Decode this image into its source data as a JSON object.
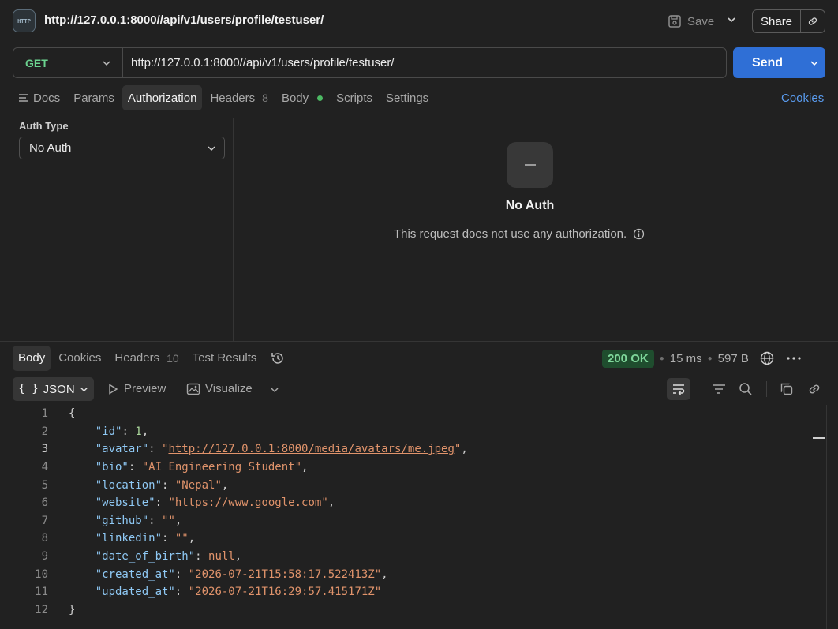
{
  "title": "http://127.0.0.1:8000//api/v1/users/profile/testuser/",
  "http_icon_text": "HTTP",
  "header": {
    "save_label": "Save",
    "share_label": "Share"
  },
  "request": {
    "method": "GET",
    "url": "http://127.0.0.1:8000//api/v1/users/profile/testuser/",
    "send_label": "Send"
  },
  "request_tabs": {
    "docs": "Docs",
    "params": "Params",
    "authorization": "Authorization",
    "headers": "Headers",
    "headers_count": "8",
    "body": "Body",
    "scripts": "Scripts",
    "settings": "Settings",
    "cookies": "Cookies"
  },
  "auth": {
    "type_label": "Auth Type",
    "selected": "No Auth",
    "empty_title": "No Auth",
    "empty_desc": "This request does not use any authorization."
  },
  "response_tabs": {
    "body": "Body",
    "cookies": "Cookies",
    "headers": "Headers",
    "headers_count": "10",
    "test_results": "Test Results"
  },
  "response_status": {
    "code": "200 OK",
    "time": "15 ms",
    "size": "597 B"
  },
  "response_toolbar": {
    "format_braces": "{ }",
    "format": "JSON",
    "preview": "Preview",
    "visualize": "Visualize"
  },
  "code_lines": [
    {
      "n": "1",
      "tokens": [
        {
          "t": "{",
          "c": "p"
        }
      ]
    },
    {
      "n": "2",
      "tokens": [
        {
          "t": "    ",
          "c": "p"
        },
        {
          "t": "\"id\"",
          "c": "k"
        },
        {
          "t": ": ",
          "c": "p"
        },
        {
          "t": "1",
          "c": "n"
        },
        {
          "t": ",",
          "c": "p"
        }
      ]
    },
    {
      "n": "3",
      "tokens": [
        {
          "t": "    ",
          "c": "p"
        },
        {
          "t": "\"avatar\"",
          "c": "k"
        },
        {
          "t": ": ",
          "c": "p"
        },
        {
          "t": "\"",
          "c": "s"
        },
        {
          "t": "http://127.0.0.1:8000/media/avatars/me.jpeg",
          "c": "u"
        },
        {
          "t": "\"",
          "c": "s"
        },
        {
          "t": ",",
          "c": "p"
        }
      ]
    },
    {
      "n": "4",
      "tokens": [
        {
          "t": "    ",
          "c": "p"
        },
        {
          "t": "\"bio\"",
          "c": "k"
        },
        {
          "t": ": ",
          "c": "p"
        },
        {
          "t": "\"AI Engineering Student\"",
          "c": "s"
        },
        {
          "t": ",",
          "c": "p"
        }
      ]
    },
    {
      "n": "5",
      "tokens": [
        {
          "t": "    ",
          "c": "p"
        },
        {
          "t": "\"location\"",
          "c": "k"
        },
        {
          "t": ": ",
          "c": "p"
        },
        {
          "t": "\"Nepal\"",
          "c": "s"
        },
        {
          "t": ",",
          "c": "p"
        }
      ]
    },
    {
      "n": "6",
      "tokens": [
        {
          "t": "    ",
          "c": "p"
        },
        {
          "t": "\"website\"",
          "c": "k"
        },
        {
          "t": ": ",
          "c": "p"
        },
        {
          "t": "\"",
          "c": "s"
        },
        {
          "t": "https://www.google.com",
          "c": "u"
        },
        {
          "t": "\"",
          "c": "s"
        },
        {
          "t": ",",
          "c": "p"
        }
      ]
    },
    {
      "n": "7",
      "tokens": [
        {
          "t": "    ",
          "c": "p"
        },
        {
          "t": "\"github\"",
          "c": "k"
        },
        {
          "t": ": ",
          "c": "p"
        },
        {
          "t": "\"\"",
          "c": "s"
        },
        {
          "t": ",",
          "c": "p"
        }
      ]
    },
    {
      "n": "8",
      "tokens": [
        {
          "t": "    ",
          "c": "p"
        },
        {
          "t": "\"linkedin\"",
          "c": "k"
        },
        {
          "t": ": ",
          "c": "p"
        },
        {
          "t": "\"\"",
          "c": "s"
        },
        {
          "t": ",",
          "c": "p"
        }
      ]
    },
    {
      "n": "9",
      "tokens": [
        {
          "t": "    ",
          "c": "p"
        },
        {
          "t": "\"date_of_birth\"",
          "c": "k"
        },
        {
          "t": ": ",
          "c": "p"
        },
        {
          "t": "null",
          "c": "nl"
        },
        {
          "t": ",",
          "c": "p"
        }
      ]
    },
    {
      "n": "10",
      "tokens": [
        {
          "t": "    ",
          "c": "p"
        },
        {
          "t": "\"created_at\"",
          "c": "k"
        },
        {
          "t": ": ",
          "c": "p"
        },
        {
          "t": "\"2026-07-21T15:58:17.522413Z\"",
          "c": "s"
        },
        {
          "t": ",",
          "c": "p"
        }
      ]
    },
    {
      "n": "11",
      "tokens": [
        {
          "t": "    ",
          "c": "p"
        },
        {
          "t": "\"updated_at\"",
          "c": "k"
        },
        {
          "t": ": ",
          "c": "p"
        },
        {
          "t": "\"2026-07-21T16:29:57.415171Z\"",
          "c": "s"
        }
      ]
    },
    {
      "n": "12",
      "tokens": [
        {
          "t": "}",
          "c": "p"
        }
      ]
    }
  ],
  "colors": {
    "accent": "#2f6fd6",
    "method": "#6bd28f",
    "status_ok": "#7fd79b",
    "link": "#5a9cf0"
  }
}
